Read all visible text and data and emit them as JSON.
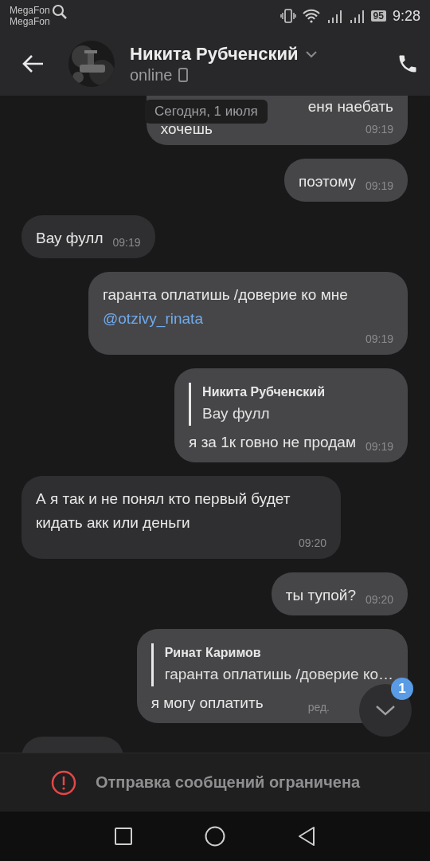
{
  "status_bar": {
    "carriers": [
      "MegaFon",
      "MegaFon"
    ],
    "battery": "95",
    "time": "9:28"
  },
  "header": {
    "name": "Никита Рубченский",
    "status": "online"
  },
  "date_pill": "Сегодня, 1 июля",
  "messages": [
    {
      "kind": "cut",
      "outgoing": true,
      "lines": [
        "еня наебать",
        "хочешь"
      ],
      "time": "09:19"
    },
    {
      "kind": "text",
      "outgoing": true,
      "text": "поэтому",
      "time": "09:19"
    },
    {
      "kind": "text",
      "outgoing": false,
      "text": "Вау фулл",
      "time": "09:19"
    },
    {
      "kind": "text",
      "outgoing": true,
      "text": "гаранта оплатишь /доверие ко мне ",
      "link": "@otzivy_rinata",
      "time": "09:19"
    },
    {
      "kind": "reply",
      "outgoing": true,
      "reply_author": "Никита Рубченский",
      "reply_text": "Вау фулл",
      "text": "я за 1к говно не продам",
      "time": "09:19"
    },
    {
      "kind": "text",
      "outgoing": false,
      "text": "А я так и не понял кто первый будет кидать акк или деньги",
      "time": "09:20"
    },
    {
      "kind": "text",
      "outgoing": true,
      "text": "ты тупой?",
      "time": "09:20"
    },
    {
      "kind": "reply",
      "outgoing": true,
      "reply_author": "Ринат Каримов",
      "reply_text": "гаранта оплатишь /доверие ко…",
      "text": "я могу оплатить",
      "edited": "ред."
    },
    {
      "kind": "partial",
      "outgoing": false
    }
  ],
  "scroll_button": {
    "badge": "1"
  },
  "restriction": {
    "text": "Отправка сообщений ограничена"
  }
}
